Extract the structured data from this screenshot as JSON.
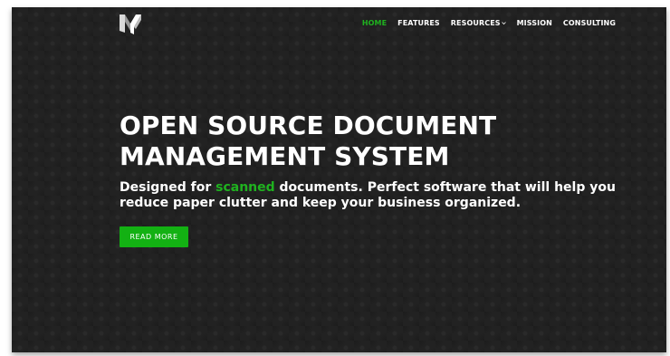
{
  "header": {
    "logo_icon": "monogram-y-logo-icon",
    "nav": [
      {
        "label": "HOME",
        "active": true
      },
      {
        "label": "FEATURES",
        "active": false
      },
      {
        "label": "RESOURCES",
        "active": false,
        "has_dropdown": true
      },
      {
        "label": "MISSION",
        "active": false
      },
      {
        "label": "CONSULTING",
        "active": false
      }
    ]
  },
  "hero": {
    "title_line1": "OPEN SOURCE DOCUMENT",
    "title_line2": "MANAGEMENT SYSTEM",
    "subtitle_before": "Designed for ",
    "subtitle_accent": "scanned",
    "subtitle_after": " documents. Perfect software that will help you reduce paper clutter and keep your business organized.",
    "cta_label": "READ MORE"
  },
  "colors": {
    "accent": "#1fb21f",
    "button": "#13b113",
    "background": "#222222",
    "text": "#ffffff"
  }
}
